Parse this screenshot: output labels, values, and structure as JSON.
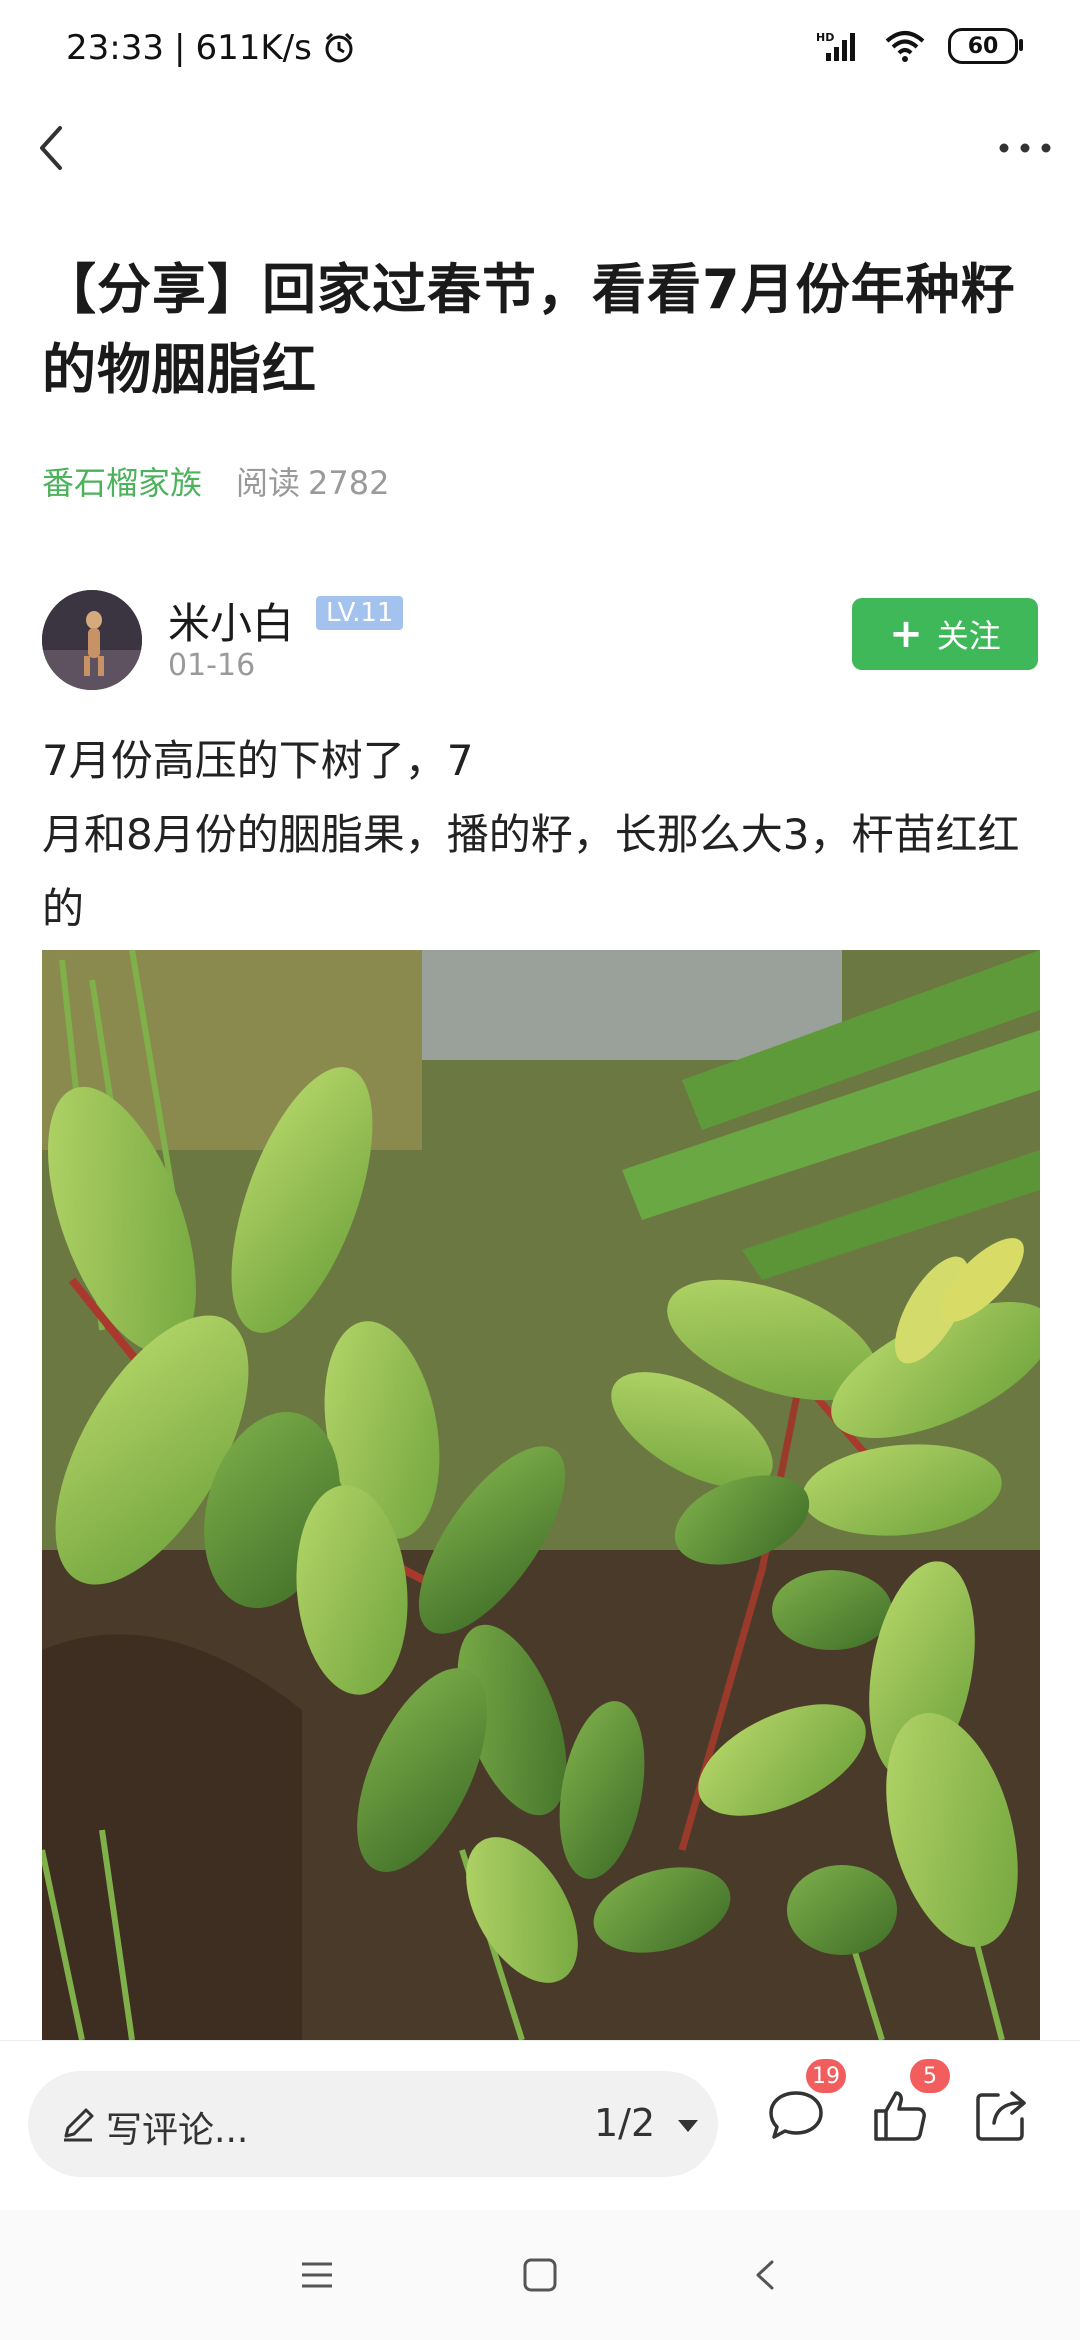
{
  "status_bar": {
    "time": "23:33",
    "speed": "611K/s",
    "network": "HD",
    "battery": "60",
    "icons": [
      "alarm-icon",
      "signal-icon",
      "wifi-icon",
      "battery-icon"
    ]
  },
  "nav": {
    "back_icon": "back-icon",
    "more_icon": "more-icon"
  },
  "post": {
    "title": "【分享】回家过春节，看看7月份年种籽的物胭脂红",
    "community": "番石榴家族",
    "reads_label": "阅读",
    "reads_count": "2782",
    "author": {
      "name": "米小白",
      "level": "LV.11",
      "date": "01-16",
      "follow_label": "关注"
    },
    "body_lines": [
      "7月份高压的下树了，7",
      "月和8月份的胭脂果，播的籽，长那么大3，杆苗红红的"
    ]
  },
  "bottom_bar": {
    "comment_placeholder": "写评论...",
    "page_indicator": "1/2",
    "comment_count": "19",
    "like_count": "5"
  },
  "colors": {
    "accent_green": "#3fb85a",
    "community_green": "#4cb25c",
    "badge_red": "#f25d5d",
    "level_blue": "#a3c3ee"
  }
}
